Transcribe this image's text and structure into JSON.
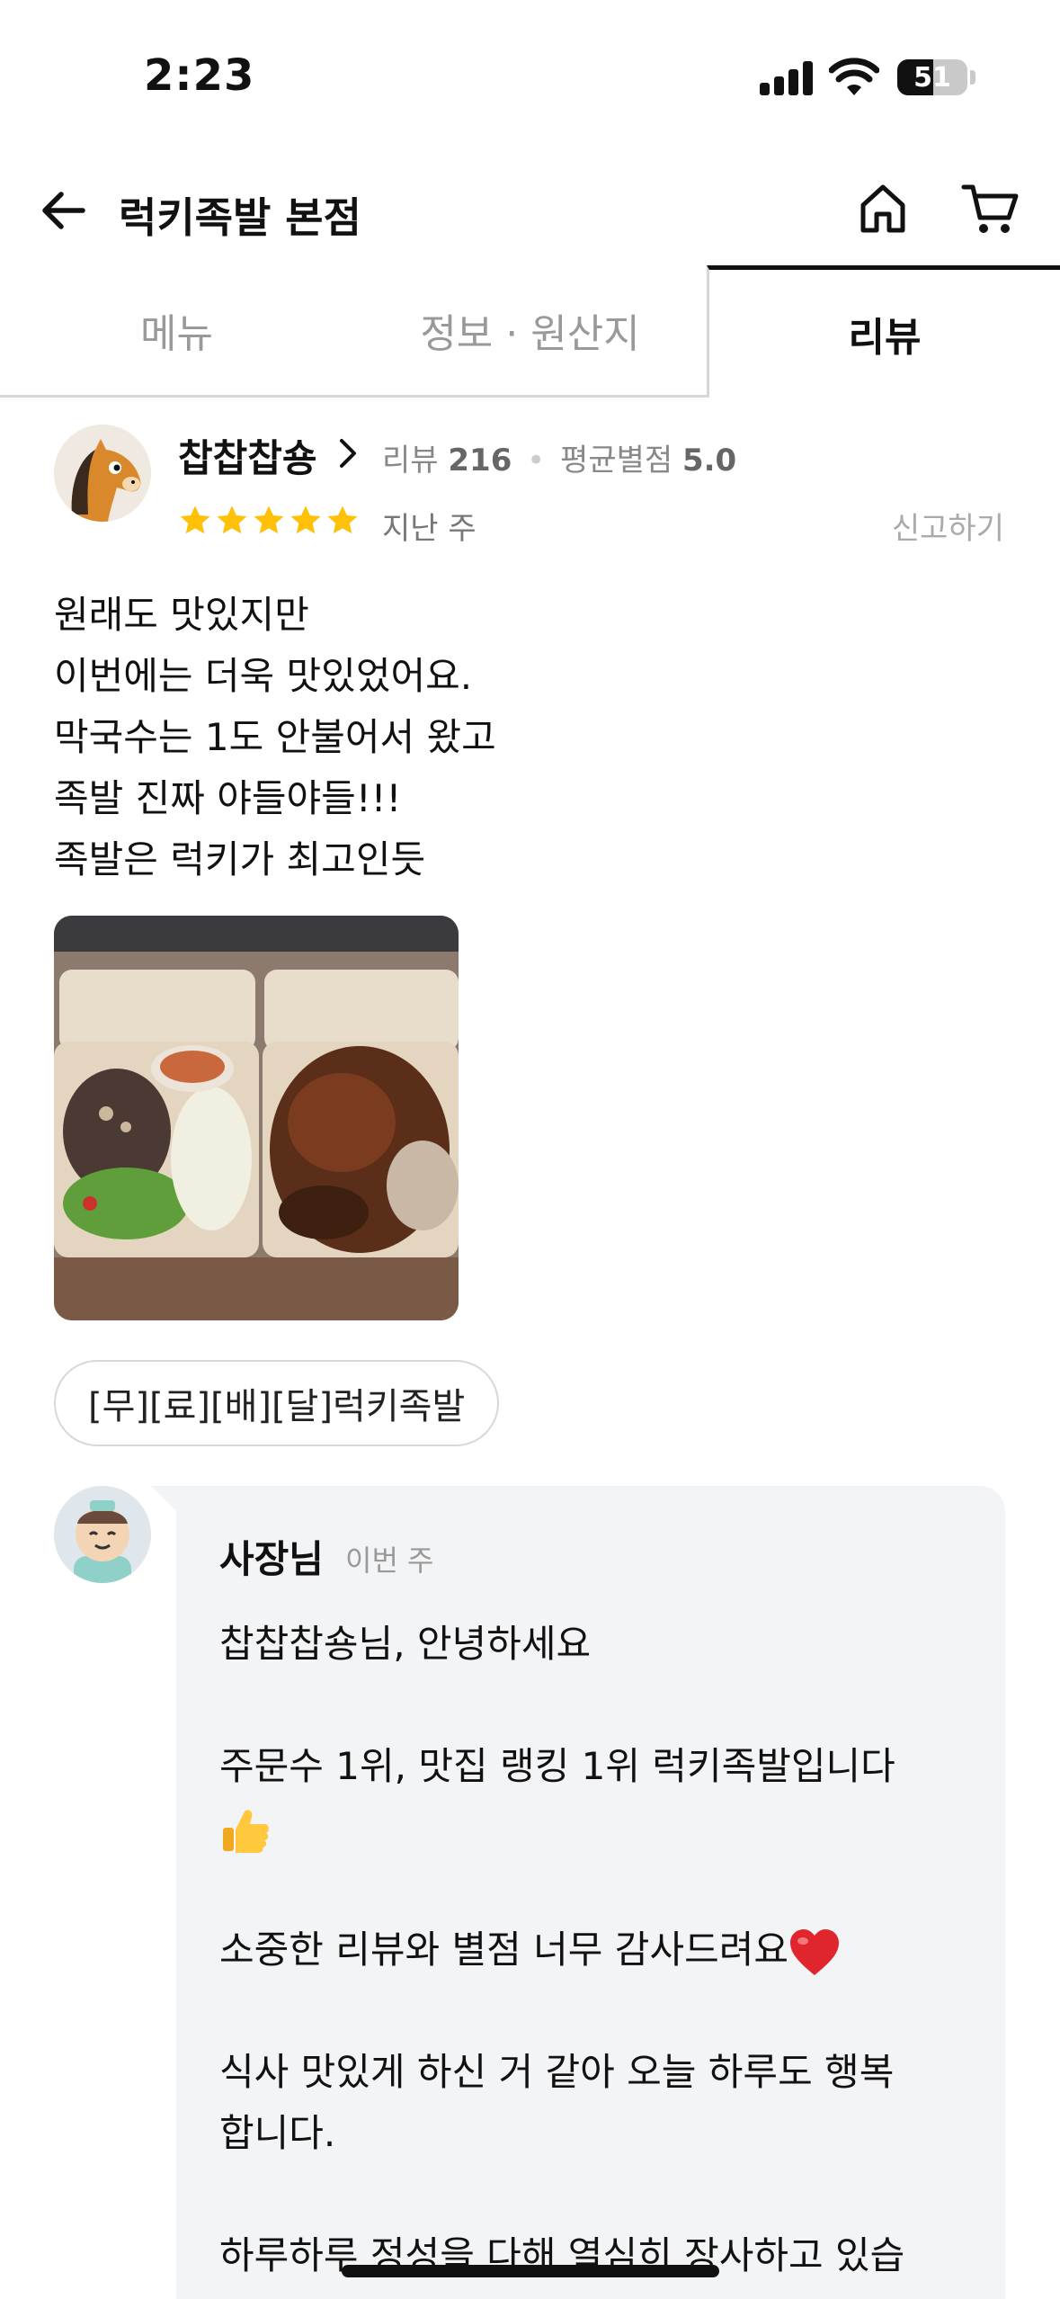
{
  "status_bar": {
    "time": "2:23",
    "battery_level": "51"
  },
  "header": {
    "title": "럭키족발 본점",
    "back_icon": "arrow-left-icon",
    "home_icon": "home-icon",
    "cart_icon": "cart-icon"
  },
  "tabs": [
    {
      "label": "메뉴",
      "active": false
    },
    {
      "label": "정보 · 원산지",
      "active": false
    },
    {
      "label": "리뷰",
      "active": true
    }
  ],
  "review": {
    "reviewer_name": "찹찹찹숑",
    "review_count_label": "리뷰",
    "review_count": "216",
    "separator": "•",
    "avg_rating_label": "평균별점",
    "avg_rating": "5.0",
    "stars": 5,
    "date": "지난 주",
    "report_label": "신고하기",
    "text_lines": [
      "원래도 맛있지만",
      "이번에는 더욱 맛있었어요.",
      "막국수는 1도 안불어서 왔고",
      "족발 진짜 야들야들!!!",
      "족발은 럭키가 최고인듯"
    ],
    "menu_chip": "[무][료][배][달]럭키족발"
  },
  "owner_reply": {
    "name": "사장님",
    "date": "이번 주",
    "lines": [
      "찹찹찹숑님, 안녕하세요",
      "",
      "주문수 1위, 맛집 랭킹 1위 럭키족발입니다",
      "",
      "",
      "소중한 리뷰와 별점 너무 감사드려요",
      "",
      "식사 맛있게 하신 거 같아 오늘 하루도 행복",
      "합니다.",
      "",
      "하루하루 정성을 다해 열심히 장사하고 있습"
    ]
  },
  "colors": {
    "star": "#FFC107",
    "active_tab_border": "#111111",
    "bubble_bg": "#F3F4F6",
    "muted_text": "#999999"
  }
}
